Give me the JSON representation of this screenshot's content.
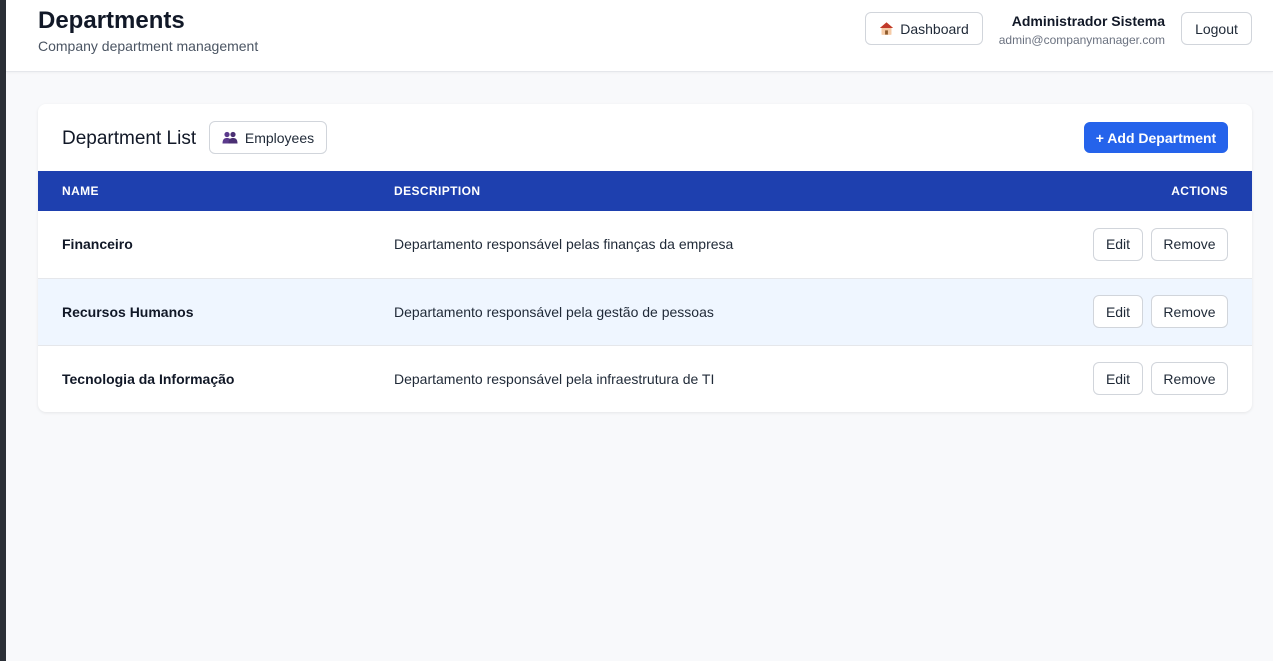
{
  "header": {
    "title": "Departments",
    "subtitle": "Company department management",
    "dashboard_label": "Dashboard",
    "user_name": "Administrador Sistema",
    "user_email": "admin@companymanager.com",
    "logout_label": "Logout"
  },
  "card": {
    "title": "Department List",
    "employees_label": "Employees",
    "add_label": "+ Add Department"
  },
  "table": {
    "headers": [
      "NAME",
      "DESCRIPTION",
      "ACTIONS"
    ],
    "rows": [
      {
        "name": "Financeiro",
        "description": "Departamento responsável pelas finanças da empresa",
        "edit": "Edit",
        "remove": "Remove"
      },
      {
        "name": "Recursos Humanos",
        "description": "Departamento responsável pela gestão de pessoas",
        "edit": "Edit",
        "remove": "Remove"
      },
      {
        "name": "Tecnologia da Informação",
        "description": "Departamento responsável pela infraestrutura de TI",
        "edit": "Edit",
        "remove": "Remove"
      }
    ]
  },
  "icons": {
    "dashboard": "house-icon",
    "employees": "users-icon"
  },
  "colors": {
    "accent": "#2563eb",
    "table_header": "#1e40af",
    "row_highlight": "#eff6ff"
  }
}
